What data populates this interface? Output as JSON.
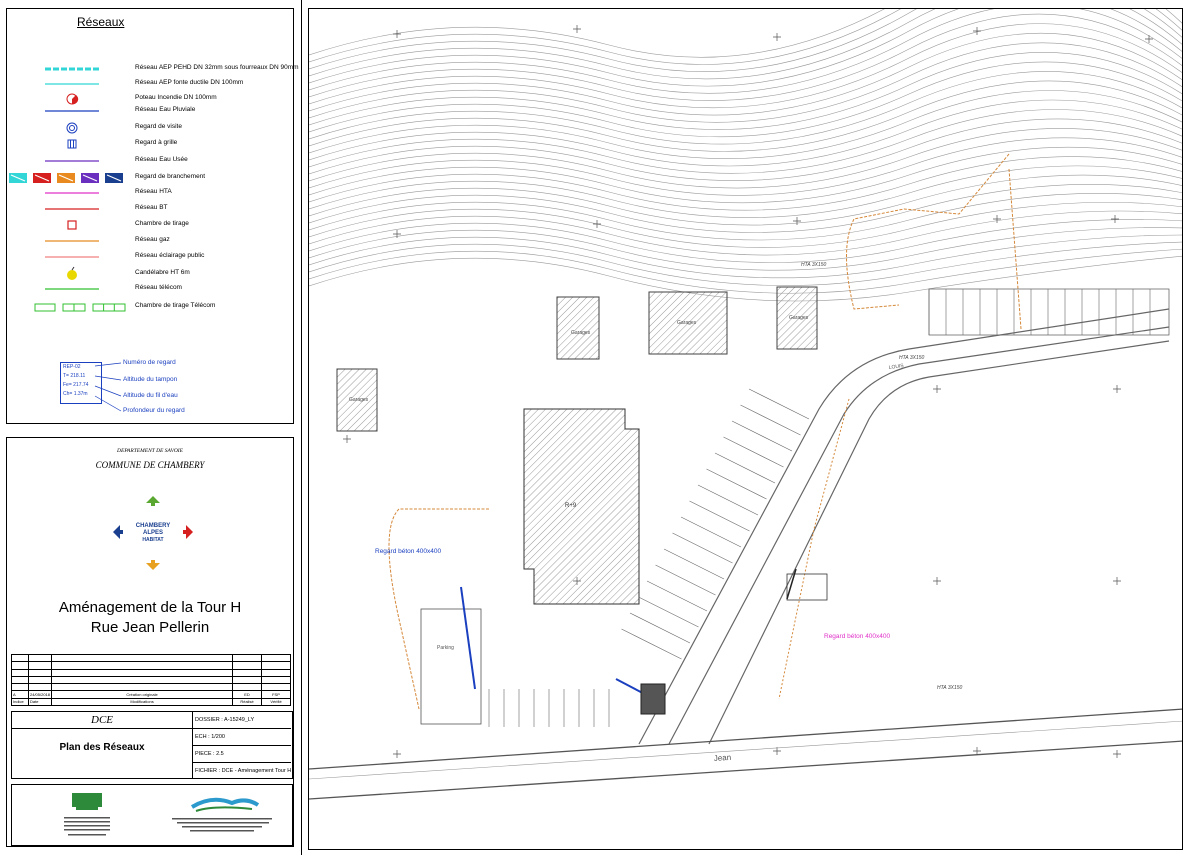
{
  "legend": {
    "title": "Réseaux",
    "items": [
      {
        "label": "Réseau AEP PEHD DN 32mm sous fourreaux DN 90mm",
        "icon": "dashed-cyan-line",
        "color": "#33d6d6"
      },
      {
        "label": "Réseau AEP fonte ductile DN 100mm",
        "icon": "cyan-line",
        "color": "#33d6d6"
      },
      {
        "label": "Poteau Incendie DN 100mm",
        "icon": "hydrant-icon",
        "color": "#d62020"
      },
      {
        "label": "Réseau Eau Pluviale",
        "icon": "blue-line",
        "color": "#1a3fbf"
      },
      {
        "label": "Regard de visite",
        "icon": "manhole-icon",
        "color": "#1a3fbf"
      },
      {
        "label": "Regard à grille",
        "icon": "grate-icon",
        "color": "#1a3fbf"
      },
      {
        "label": "Réseau Eau Usée",
        "icon": "violet-line",
        "color": "#6b2fbf"
      },
      {
        "label": "Regard de branchement",
        "icon": "branch-box-icons",
        "color": "#d62020"
      },
      {
        "label": "Réseau HTA",
        "icon": "magenta-line",
        "color": "#e030c8"
      },
      {
        "label": "Réseau BT",
        "icon": "red-line",
        "color": "#d62020"
      },
      {
        "label": "Chambre de tirage",
        "icon": "square-icon",
        "color": "#d62020"
      },
      {
        "label": "Réseau gaz",
        "icon": "orange-line",
        "color": "#e88a20"
      },
      {
        "label": "Réseau éclairage public",
        "icon": "pink-line",
        "color": "#f08080"
      },
      {
        "label": "Candélabre HT 6m",
        "icon": "lamp-icon",
        "color": "#e8d800"
      },
      {
        "label": "Réseau télécom",
        "icon": "green-line",
        "color": "#30c030"
      },
      {
        "label": "Chambre de tirage Télécom",
        "icon": "telecom-box-icons",
        "color": "#30c030"
      }
    ],
    "annotation": {
      "box_lines": [
        "REP-02",
        "T= 218.11",
        "Fe= 217.74",
        "Ch= 1.37m"
      ],
      "labels": [
        "Numéro de regard",
        "Altitude du tampon",
        "Altitude du fil d'eau",
        "Profondeur du regard"
      ]
    }
  },
  "titleblock": {
    "department": "DEPARTEMENT DE SAVOIE",
    "commune": "COMMUNE DE CHAMBERY",
    "logo_text": [
      "CHAMBERY",
      "ALPES",
      "HABITAT"
    ],
    "project_line1": "Aménagement de la Tour H",
    "project_line2": "Rue Jean Pellerin",
    "revision": {
      "index": "A",
      "date": "24/05/2018",
      "modification": "Création originale",
      "author": "ED",
      "checker": "FSP"
    },
    "revision_headers": [
      "Indice",
      "Date",
      "Modifications",
      "Réalisé",
      "Vérifié"
    ],
    "phase": "DCE",
    "plan_title": "Plan des Réseaux",
    "dossier": "DOSSIER : A-15249_LY",
    "scale": "ECH : 1/200",
    "piece": "PIECE : 2.5",
    "fichier": "FICHIER : DCE - Aménagement Tour H.dwg"
  },
  "map": {
    "labels": {
      "regard_blue": "Regard béton 400x400",
      "regard_magenta": "Regard béton 400x400",
      "garage1": "Garages",
      "garage2": "Garages",
      "garage3": "Garages",
      "garage4": "Garages",
      "street": "Jean",
      "street2": "LOUIS",
      "building": "R+9",
      "hta1": "HTA 3X150",
      "hta2": "HTA 3X150",
      "hta3": "HTA 3X150",
      "parking": "Parking"
    },
    "colors": {
      "lines": "#8a8a8a",
      "dark": "#404040",
      "orange": "#d4883a",
      "blue": "#1a3fbf",
      "magenta": "#e030c8"
    }
  }
}
